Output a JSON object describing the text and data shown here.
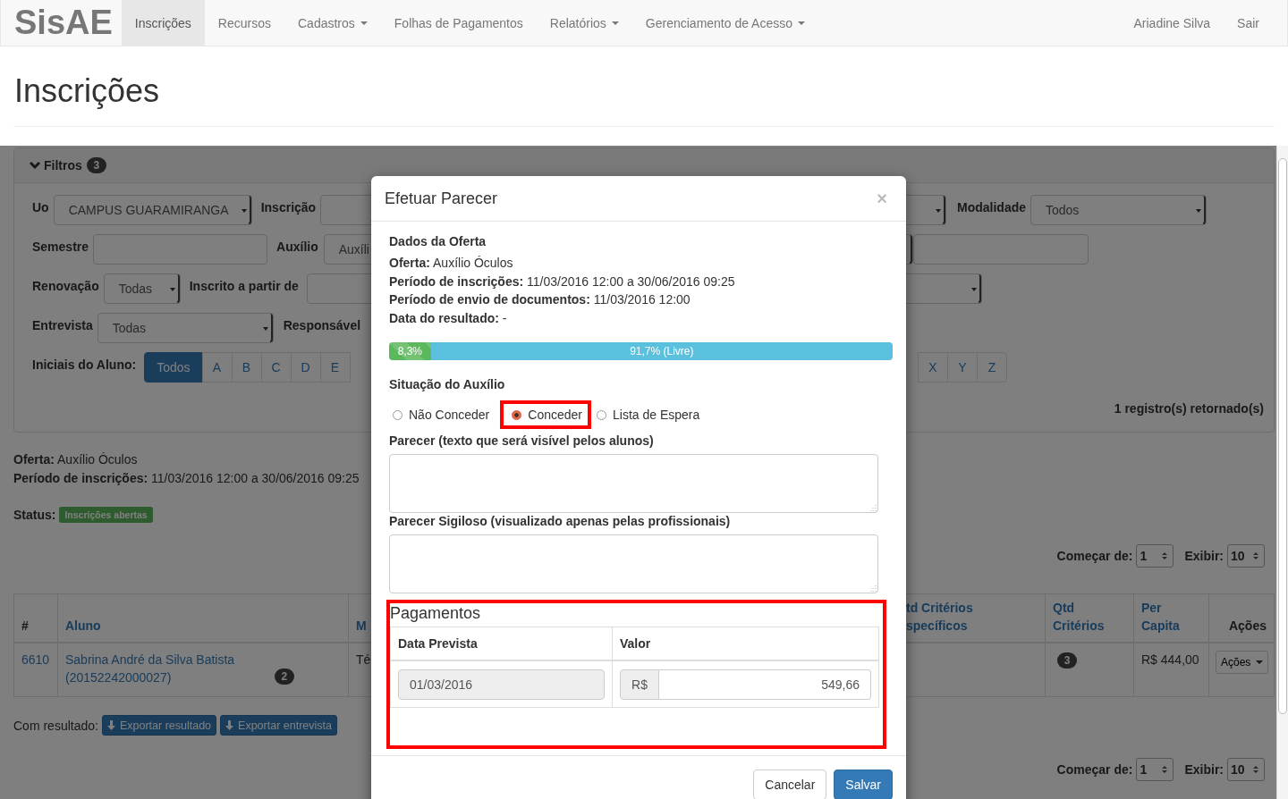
{
  "navbar": {
    "brand": "SisAE",
    "items": [
      {
        "label": "Inscrições",
        "selected": true,
        "dropdown": false
      },
      {
        "label": "Recursos",
        "selected": false,
        "dropdown": false
      },
      {
        "label": "Cadastros",
        "selected": false,
        "dropdown": true
      },
      {
        "label": "Folhas de Pagamentos",
        "selected": false,
        "dropdown": false
      },
      {
        "label": "Relatórios",
        "selected": false,
        "dropdown": true
      },
      {
        "label": "Gerenciamento de Acesso",
        "selected": false,
        "dropdown": true
      }
    ],
    "right_items": [
      "Ariadine Silva",
      "Sair"
    ]
  },
  "page_title": "Inscrições",
  "filters": {
    "title": "Filtros",
    "count": "3",
    "expanded": true,
    "uo": {
      "label": "Uo",
      "value": "CAMPUS GUARAMIRANGA"
    },
    "inscricao": {
      "label": "Inscrição"
    },
    "modalidade": {
      "label": "Modalidade",
      "value": "Todos"
    },
    "semestre": {
      "label": "Semestre"
    },
    "auxilio": {
      "label": "Auxílio",
      "value": "Auxíli"
    },
    "renovacao": {
      "label": "Renovação",
      "value": "Todas"
    },
    "inscrito_a_partir_de": {
      "label": "Inscrito a partir de"
    },
    "entrevista": {
      "label": "Entrevista",
      "value": "Todas"
    },
    "responsavel": {
      "label": "Responsável"
    },
    "initials_label": "Iniciais do Aluno:",
    "initials": [
      {
        "label": "Todos",
        "selected": true
      },
      {
        "label": "A",
        "selected": false
      },
      {
        "label": "B",
        "selected": false
      },
      {
        "label": "C",
        "selected": false
      },
      {
        "label": "D",
        "selected": false
      },
      {
        "label": "E",
        "selected": false
      }
    ],
    "initials_end": [
      {
        "label": "X",
        "selected": false
      },
      {
        "label": "Y",
        "selected": false
      },
      {
        "label": "Z",
        "selected": false
      }
    ],
    "result_count": "1 registro(s) retornado(s)"
  },
  "offer": {
    "lines": [
      "**Oferta:** Auxílio Óculos",
      "**Período de inscrições:** 11/03/2016 12:00 a 30/06/2016 09:25"
    ],
    "status_label": "Status:",
    "status": "Inscrições abertas"
  },
  "pager_top": {
    "start_label": "Começar de:",
    "start": "1",
    "show_label": "Exibir:",
    "show": "10"
  },
  "table": {
    "columns_left": [
      {
        "label": "#",
        "sortable": false
      },
      {
        "label": "Aluno",
        "sortable": true
      },
      {
        "label": "M",
        "sortable": true
      }
    ],
    "columns_right": [
      {
        "label": "td Critérios specíficos",
        "sortable": true
      },
      {
        "label": "Qtd Critérios",
        "sortable": true
      },
      {
        "label": "Per Capita",
        "sortable": true
      },
      {
        "label": "Ações",
        "sortable": false
      }
    ],
    "rows": [
      {
        "id": "6610",
        "aluno": "Sabrina André da Silva Batista (20152242000027)",
        "aluno_badge": "2",
        "column_3": "Té",
        "qtd_criterios": "3",
        "per_capita": "R$ 444,00",
        "actions": "Ações"
      }
    ]
  },
  "export": {
    "label": "Com resultado:",
    "buttons": [
      "Exportar resultado",
      "Exportar entrevista"
    ]
  },
  "pager_bottom": {
    "start_label": "Começar de:",
    "start": "1",
    "show_label": "Exibir:",
    "show": "10"
  },
  "modal": {
    "title": "Efetuar Parecer",
    "close": "×",
    "section_title": "Dados da Oferta",
    "details": [
      "**Oferta:** Auxílio Óculos",
      "**Período de inscrições:** 11/03/2016 12:00 a 30/06/2016 09:25",
      "**Período de envio de documentos:** 11/03/2016 12:00",
      "**Data do resultado:** -"
    ],
    "capacity": [
      {
        "kind": "used",
        "label": "8,3%",
        "level": 0.083
      },
      {
        "kind": "free",
        "label": "91,7% (Livre)",
        "level": 0.917
      }
    ],
    "situation_label": "Situação do Auxílio",
    "options": [
      {
        "label": "Não Conceder",
        "selected": false,
        "highlighted": false
      },
      {
        "label": "Conceder",
        "selected": true,
        "highlighted": true
      },
      {
        "label": "Lista de Espera",
        "selected": false,
        "highlighted": false
      }
    ],
    "parecer_label": "Parecer (texto que será visível pelos alunos)",
    "sigiloso_label": "Parecer Sigiloso (visualizado apenas pelas profissionais)",
    "payments": {
      "title": "Pagamentos",
      "highlighted": true,
      "columns": [
        "Data Prevista",
        "Valor"
      ],
      "rows": [
        {
          "date": "01/03/2016",
          "currency": "R$",
          "value": "549,66"
        }
      ]
    },
    "buttons": [
      {
        "label": "Cancelar",
        "kind": "default"
      },
      {
        "label": "Salvar",
        "kind": "primary"
      }
    ]
  }
}
